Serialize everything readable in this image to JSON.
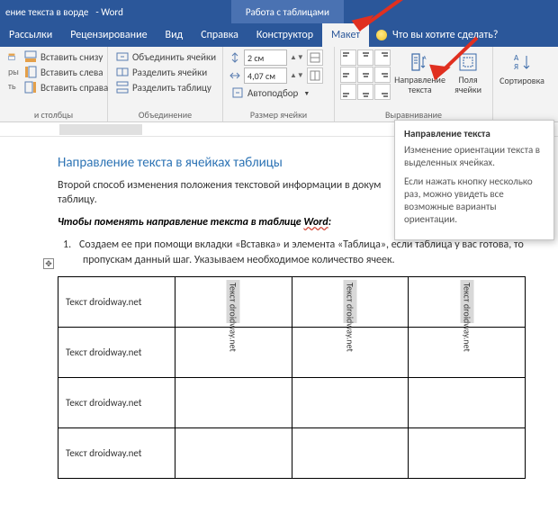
{
  "titlebar": {
    "doc": "ение текста в ворде",
    "prod": "- Word",
    "context": "Работа с таблицами"
  },
  "tabs": {
    "items": [
      "Рассылки",
      "Рецензирование",
      "Вид",
      "Справка",
      "Конструктор",
      "Макет"
    ],
    "tell": "Что вы хотите сделать?"
  },
  "ribbon": {
    "insert": {
      "below": "Вставить снизу",
      "left": "Вставить слева",
      "right": "Вставить справа",
      "label": "и столбцы"
    },
    "merge": {
      "merge": "Объединить ячейки",
      "splitCells": "Разделить ячейки",
      "splitTable": "Разделить таблицу",
      "label": "Объединение"
    },
    "size": {
      "height": "2 см",
      "width": "4,07 см",
      "auto": "Автоподбор",
      "label": "Размер ячейки"
    },
    "align": {
      "direction": "Направление текста",
      "margins": "Поля ячейки",
      "label": "Выравнивание"
    },
    "data": {
      "sort": "Сортировка"
    }
  },
  "tooltip": {
    "title": "Направление текста",
    "p1": "Изменение ориентации текста в выделенных ячейках.",
    "p2": "Если нажать кнопку несколько раз, можно увидеть все возможные варианты ориентации."
  },
  "document": {
    "heading": "Направление текста в ячейках таблицы",
    "para1a": "Второй способ изменения положения текстовой информации в докум",
    "para1b": "таблицу.",
    "boldA": "Чтобы поменять направление текста в ",
    "boldB": "таблице ",
    "boldC": "Word",
    "listNum": "1.",
    "listText": "Создаем ее при помощи вкладки «Вставка» и элемента «Таблица», если таблица у вас готова, то пропускам данный шаг. Указываем необходимое количество ячеек.",
    "cellH": "Текст droidway.net",
    "cellV": "Текст droidway.net",
    "anchor": "✥"
  }
}
